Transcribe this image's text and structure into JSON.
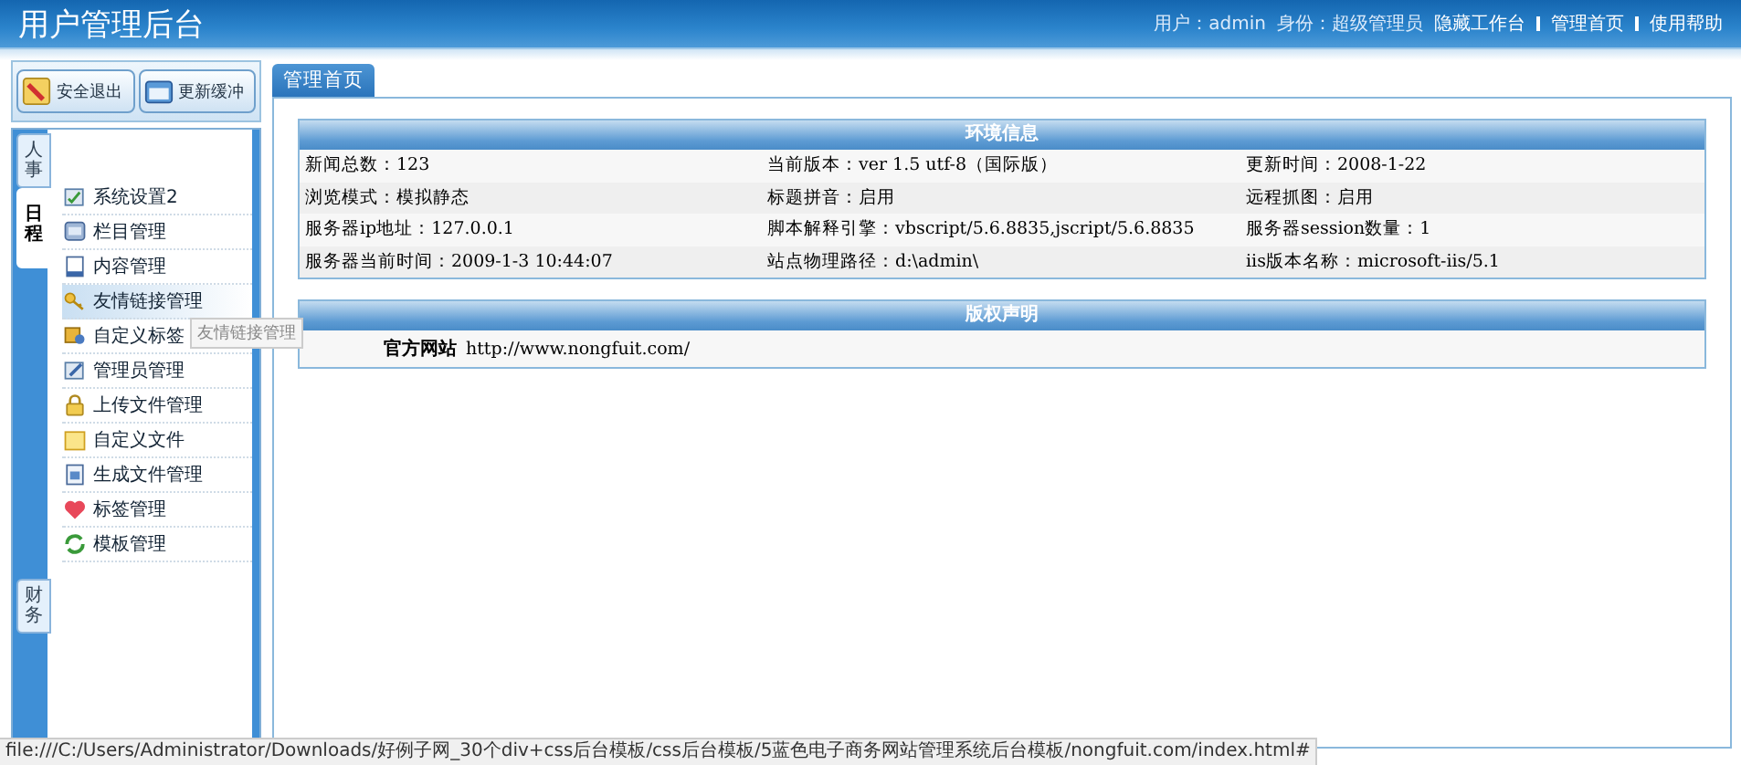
{
  "header": {
    "title": "用户管理后台",
    "user_label": "用户：admin",
    "role_label": "身份：超级管理员",
    "links": [
      {
        "label": "隐藏工作台"
      },
      {
        "label": "管理首页"
      },
      {
        "label": "使用帮助"
      }
    ]
  },
  "top_buttons": [
    {
      "label": "安全退出"
    },
    {
      "label": "更新缓冲"
    }
  ],
  "side_tabs": [
    {
      "label": "人事",
      "selected": false
    },
    {
      "label": "日程",
      "selected": true
    },
    {
      "label": "财务",
      "selected": false
    }
  ],
  "menu_items": [
    {
      "label": "系统设置2",
      "highlighted": false
    },
    {
      "label": "栏目管理",
      "highlighted": false
    },
    {
      "label": "内容管理",
      "highlighted": false
    },
    {
      "label": "友情链接管理",
      "highlighted": true
    },
    {
      "label": "自定义标签",
      "highlighted": false
    },
    {
      "label": "管理员管理",
      "highlighted": false
    },
    {
      "label": "上传文件管理",
      "highlighted": false
    },
    {
      "label": "自定义文件",
      "highlighted": false
    },
    {
      "label": "生成文件管理",
      "highlighted": false
    },
    {
      "label": "标签管理",
      "highlighted": false
    },
    {
      "label": "模板管理",
      "highlighted": false
    }
  ],
  "tooltip": {
    "text": "友情链接管理"
  },
  "main_tabs": [
    {
      "label": "管理首页",
      "selected": true
    }
  ],
  "env_table": {
    "title": "环境信息",
    "rows": [
      [
        "新闻总数：123",
        "当前版本：ver 1.5 utf-8（国际版）",
        "更新时间：2008-1-22"
      ],
      [
        "浏览模式：模拟静态",
        "标题拼音：启用",
        "远程抓图：启用"
      ],
      [
        "服务器ip地址：127.0.0.1",
        "脚本解释引擎：vbscript/5.6.8835,jscript/5.6.8835",
        "服务器session数量：1"
      ],
      [
        "服务器当前时间：2009-1-3 10:44:07",
        "站点物理路径：d:\\admin\\",
        "iis版本名称：microsoft-iis/5.1"
      ]
    ]
  },
  "copyright_table": {
    "title": "版权声明",
    "label": "官方网站",
    "url": "http://www.nongfuit.com/"
  },
  "status_bar": {
    "text": "file:///C:/Users/Administrator/Downloads/好例子网_30个div+css后台模板/css后台模板/5蓝色电子商务网站管理系统后台模板/nongfuit.com/index.html#"
  }
}
